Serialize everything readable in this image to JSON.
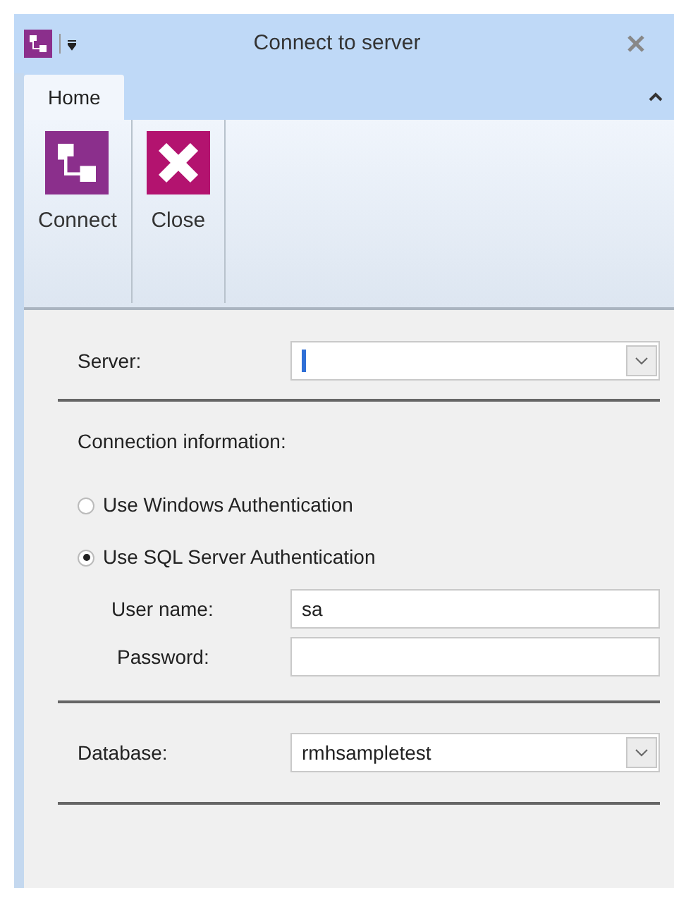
{
  "window": {
    "title": "Connect to server"
  },
  "tabs": [
    {
      "label": "Home",
      "selected": true
    }
  ],
  "ribbon": [
    {
      "label": "Connect",
      "kind": "connect"
    },
    {
      "label": "Close",
      "kind": "close"
    }
  ],
  "server": {
    "label": "Server:"
  },
  "connection": {
    "heading": "Connection information:",
    "auth_options": [
      {
        "label": "Use Windows Authentication",
        "selected": false
      },
      {
        "label": "Use SQL Server Authentication",
        "selected": true
      }
    ],
    "user_name": {
      "label": "User name:",
      "value": "sa"
    },
    "password": {
      "label": "Password:"
    }
  },
  "database": {
    "label": "Database:",
    "value": "rmhsampletest"
  }
}
